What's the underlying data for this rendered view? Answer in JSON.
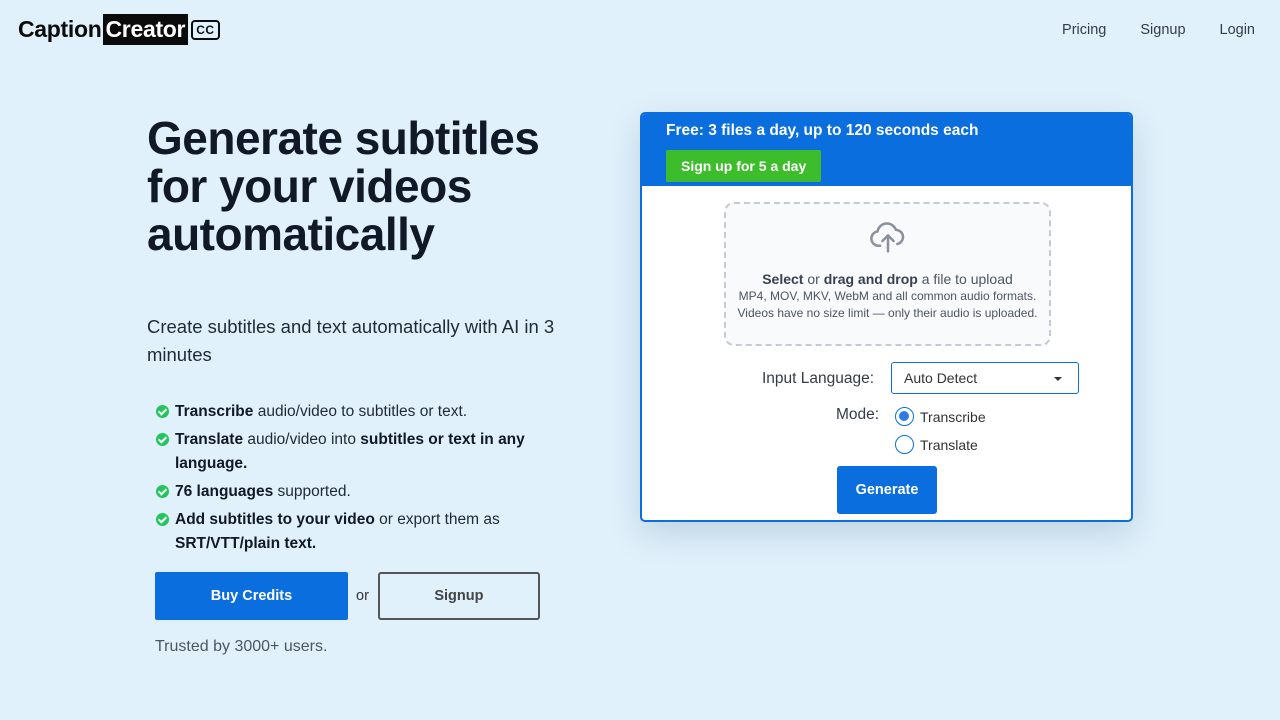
{
  "brand": {
    "word1": "Caption",
    "word2": "Creator",
    "badge": "CC"
  },
  "nav": {
    "pricing": "Pricing",
    "signup": "Signup",
    "login": "Login"
  },
  "hero": {
    "title": "Generate subtitles for your videos automatically",
    "subtitle": "Create subtitles and text automatically with AI in 3 minutes"
  },
  "features": [
    {
      "b1": "Transcribe",
      "t1": " audio/video to subtitles or text.",
      "b2": "",
      "t2": ""
    },
    {
      "b1": "Translate",
      "t1": " audio/video into ",
      "b2": "subtitles or text in any language.",
      "t2": ""
    },
    {
      "b1": "76 languages",
      "t1": " supported.",
      "b2": "",
      "t2": ""
    },
    {
      "b1": "Add subtitles to your video",
      "t1": " or export them as ",
      "b2": "SRT/VTT/plain text.",
      "t2": ""
    }
  ],
  "cta": {
    "buy": "Buy Credits",
    "or": "or",
    "signup": "Signup"
  },
  "trusted": "Trusted by 3000+ users.",
  "card": {
    "limit": "Free: 3 files a day, up to 120 seconds each",
    "upgrade": "Sign up for 5 a day",
    "dropzone": {
      "select": "Select",
      "or": " or ",
      "drag": "drag and drop",
      "rest": " a file to upload",
      "formats": "MP4, MOV, MKV, WebM and all common audio formats.",
      "note": "Videos have no size limit — only their audio is uploaded."
    },
    "language_label": "Input Language:",
    "language_value": "Auto Detect",
    "mode_label": "Mode:",
    "modes": [
      "Transcribe",
      "Translate"
    ],
    "selected_mode": "Transcribe",
    "generate": "Generate"
  },
  "colors": {
    "primary": "#0a6edf",
    "green": "#3dbd2c",
    "check": "#22c55e",
    "background": "#e0f1fc"
  },
  "icons": {
    "upload": "cloud-upload-icon",
    "check": "check-circle-icon",
    "caret": "caret-down-icon"
  }
}
